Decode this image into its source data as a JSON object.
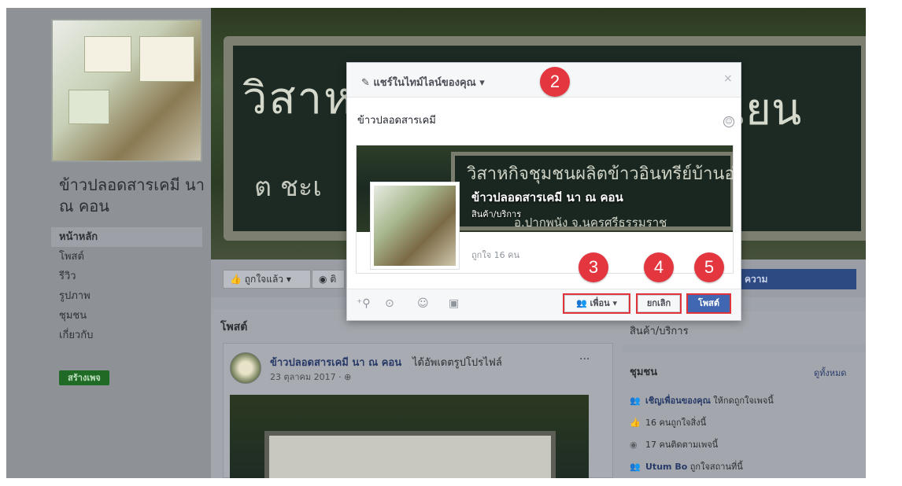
{
  "page": {
    "name": "ข้าวปลอดสารเคมี นา ณ คอน",
    "nav": [
      "หน้าหลัก",
      "โพสต์",
      "รีวิว",
      "รูปภาพ",
      "ชุมชน",
      "เกี่ยวกับ"
    ],
    "create_page": "สร้างเพจ"
  },
  "cover": {
    "sign_left": "วิสาหกิ",
    "sign_right": "เียน",
    "sign_bottom": "ต ชะเ"
  },
  "actions": {
    "liked": "ถูกใจแล้ว",
    "follow": "ติ",
    "message": "ความ"
  },
  "posts": {
    "title": "โพสต์",
    "post": {
      "author": "ข้าวปลอดสารเคมี นา ณ คอน",
      "action": "ได้อัพเดตรูปโปรไฟล์",
      "date": "23 ตุลาคม 2017 · ",
      "menu": "···"
    }
  },
  "right": {
    "products": "สินค้า/บริการ",
    "community": {
      "title": "ชุมชน",
      "see_all": "ดูทั้งหมด",
      "invite_link": "เชิญเพื่อนของคุณ",
      "invite_rest": " ให้กดถูกใจเพจนี้",
      "likes": "16 คนถูกใจสิ่งนี้",
      "follows": "17 คนติดตามเพจนี้",
      "user": "Utum Bo",
      "user_rest": " ถูกใจสถานที่นี้"
    }
  },
  "modal": {
    "title": "แชร์ในไทม์ไลน์ของคุณ",
    "close": "×",
    "text": "ข้าวปลอดสารเคมี",
    "share": {
      "name": "ข้าวปลอดสารเคมี นา ณ คอน",
      "category": "สินค้า/บริการ",
      "likes": "ถูกใจ 16 คน",
      "cover_line1": "วิสาหกิจชุมชนผลิตข้าวอินทรีย์บ้านอ่าวเคียน",
      "cover_line2": "อ.ปากพนัง จ.นครศรีธรรมราช"
    },
    "audience": "เพื่อน",
    "cancel": "ยกเลิก",
    "post": "โพสต์"
  },
  "badges": [
    "2",
    "3",
    "4",
    "5"
  ],
  "icons": {
    "tag_friends": "tag-friends-icon",
    "location": "location-icon",
    "feeling": "feeling-icon",
    "sticker": "sticker-icon"
  },
  "colors": {
    "primary_blue": "#4267b2",
    "badge_red": "#e3363f",
    "link_blue": "#283a68"
  }
}
